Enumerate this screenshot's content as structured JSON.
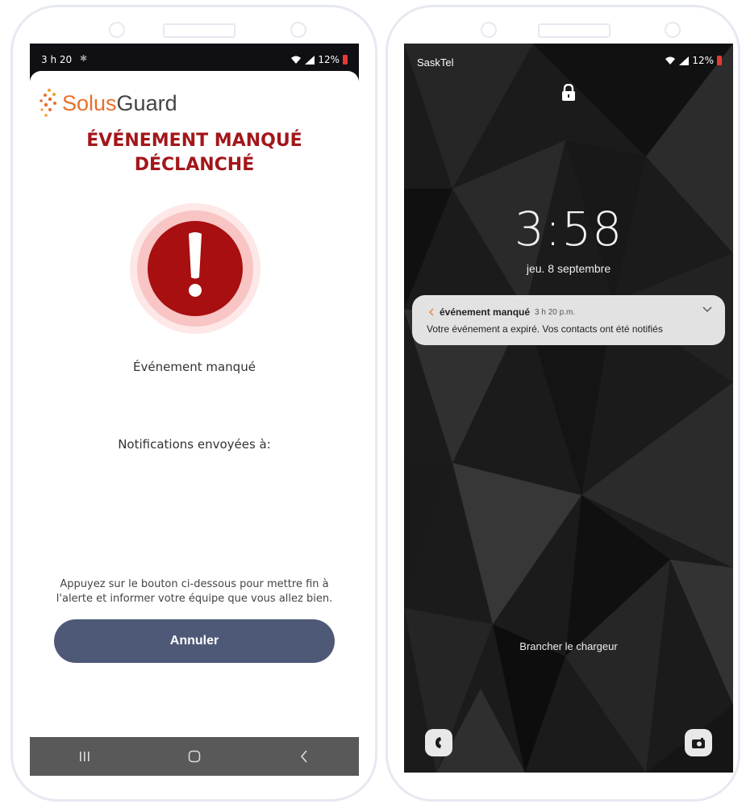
{
  "left_phone": {
    "status_bar": {
      "time": "3 h 20",
      "battery": "12%"
    },
    "logo": {
      "part1": "Solus",
      "part2": "Guard"
    },
    "title_line1": "ÉVÉNEMENT MANQUÉ",
    "title_line2": "DÉCLANCHÉ",
    "event_label": "Événement manqué",
    "notifications_label": "Notifications envoyées à:",
    "instructions": "Appuyez sur le bouton ci-dessous pour mettre fin à l'alerte et informer votre équipe que vous allez bien.",
    "cancel_button": "Annuler"
  },
  "right_phone": {
    "status_bar": {
      "carrier": "SaskTel",
      "battery": "12%"
    },
    "clock": "3:58",
    "date": "jeu. 8 septembre",
    "notification": {
      "title": "événement manqué",
      "time": "3 h 20 p.m.",
      "body": "Votre événement a expiré. Vos contacts ont été notifiés"
    },
    "charge_message": "Brancher le chargeur"
  },
  "colors": {
    "brand_orange": "#e8702a",
    "alert_red": "#a3161a",
    "button": "#4e5977"
  }
}
